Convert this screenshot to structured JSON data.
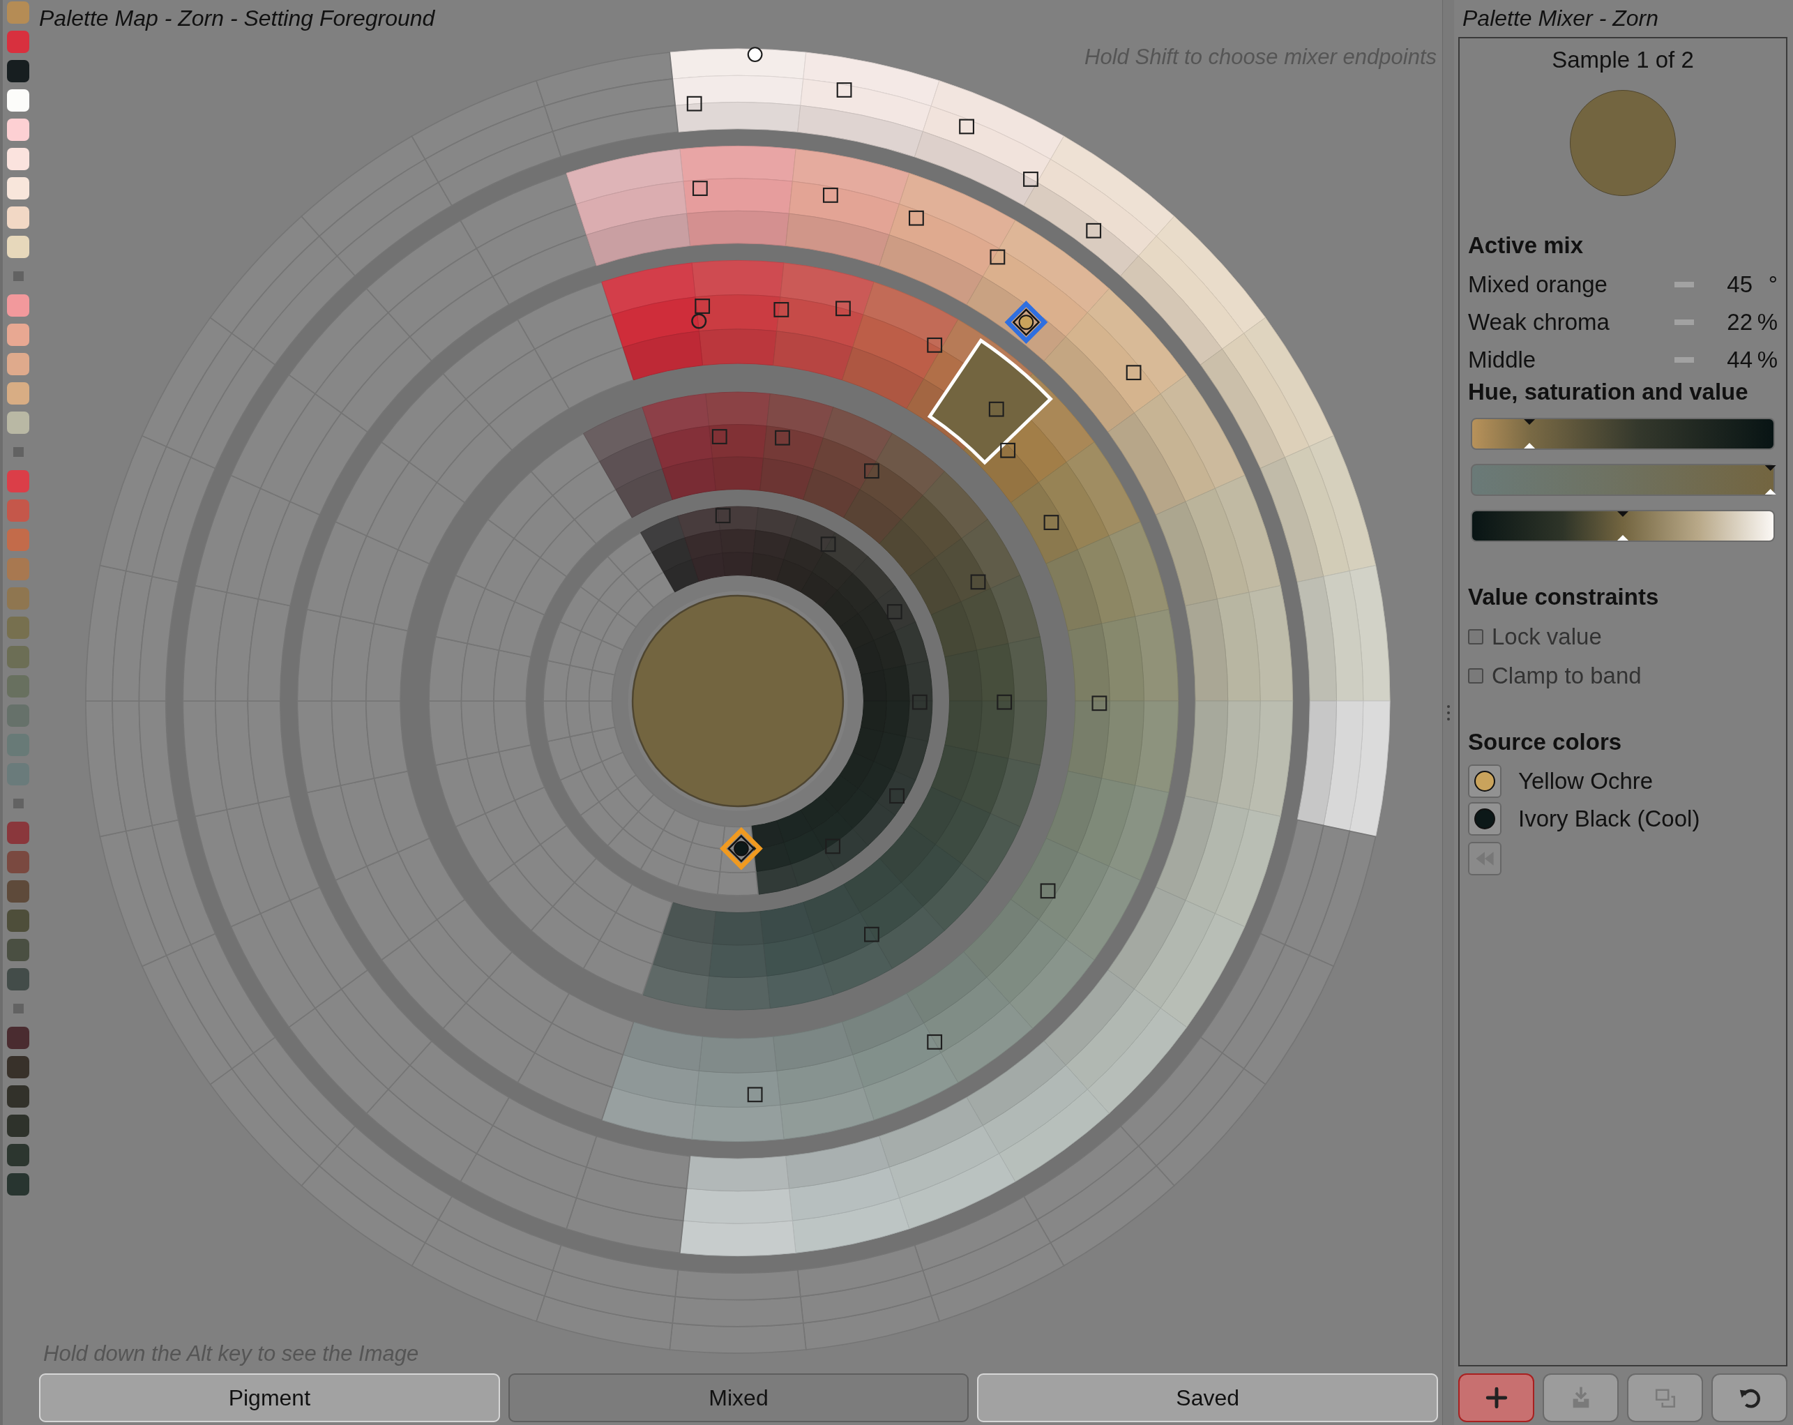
{
  "palette_map": {
    "title": "Palette Map - Zorn - Setting Foreground",
    "hint_top": "Hold Shift to choose mixer endpoints",
    "hint_bottom": "Hold down the Alt key to see the Image",
    "swatches": [
      {
        "kind": "swatch",
        "color": "#b58c55"
      },
      {
        "kind": "swatch",
        "color": "#d8303e"
      },
      {
        "kind": "swatch",
        "color": "#171e20"
      },
      {
        "kind": "swatch",
        "color": "#fcfcfa"
      },
      {
        "kind": "swatch",
        "color": "#fdd0d3"
      },
      {
        "kind": "swatch",
        "color": "#fbe3de"
      },
      {
        "kind": "swatch",
        "color": "#f8e6db"
      },
      {
        "kind": "swatch",
        "color": "#f2d8c5"
      },
      {
        "kind": "swatch",
        "color": "#e7d8bb"
      },
      {
        "kind": "separator"
      },
      {
        "kind": "swatch",
        "color": "#f2999c"
      },
      {
        "kind": "swatch",
        "color": "#e8a892"
      },
      {
        "kind": "swatch",
        "color": "#dfaa8c"
      },
      {
        "kind": "swatch",
        "color": "#d8ad84"
      },
      {
        "kind": "swatch",
        "color": "#b9b8a4"
      },
      {
        "kind": "separator"
      },
      {
        "kind": "swatch",
        "color": "#db3e48"
      },
      {
        "kind": "swatch",
        "color": "#c5574a"
      },
      {
        "kind": "swatch",
        "color": "#c36b4a"
      },
      {
        "kind": "swatch",
        "color": "#a87850"
      },
      {
        "kind": "swatch",
        "color": "#8f7650"
      },
      {
        "kind": "swatch",
        "color": "#77704f"
      },
      {
        "kind": "swatch",
        "color": "#6c6e55"
      },
      {
        "kind": "swatch",
        "color": "#68705f"
      },
      {
        "kind": "swatch",
        "color": "#66716a"
      },
      {
        "kind": "swatch",
        "color": "#687a77"
      },
      {
        "kind": "swatch",
        "color": "#6a7b7b"
      },
      {
        "kind": "separator"
      },
      {
        "kind": "swatch",
        "color": "#8a373c"
      },
      {
        "kind": "swatch",
        "color": "#7a4940"
      },
      {
        "kind": "swatch",
        "color": "#5e4a3a"
      },
      {
        "kind": "swatch",
        "color": "#4e4e3a"
      },
      {
        "kind": "swatch",
        "color": "#4a4f42"
      },
      {
        "kind": "swatch",
        "color": "#434c49"
      },
      {
        "kind": "separator"
      },
      {
        "kind": "swatch",
        "color": "#4a2c30"
      },
      {
        "kind": "swatch",
        "color": "#38312a"
      },
      {
        "kind": "swatch",
        "color": "#32312a"
      },
      {
        "kind": "swatch",
        "color": "#2e322b"
      },
      {
        "kind": "swatch",
        "color": "#2c362f"
      },
      {
        "kind": "swatch",
        "color": "#283530"
      }
    ],
    "tabs": [
      {
        "label": "Pigment",
        "selected": false
      },
      {
        "label": "Mixed",
        "selected": true
      },
      {
        "label": "Saved",
        "selected": false
      }
    ]
  },
  "palette_mixer": {
    "title": "Palette Mixer - Zorn",
    "sample": {
      "label": "Sample 1 of 2",
      "color": "#736540"
    },
    "active_mix": {
      "heading": "Active mix",
      "rows": [
        {
          "label": "Mixed orange",
          "value": "45",
          "unit": "°"
        },
        {
          "label": "Weak chroma",
          "value": "22",
          "unit": "%"
        },
        {
          "label": "Middle",
          "value": "44",
          "unit": "%"
        }
      ]
    },
    "hsv": {
      "heading": "Hue, saturation and value",
      "bars": [
        {
          "kind": "hue",
          "level": 0.19
        },
        {
          "kind": "saturation",
          "level": 0.99
        },
        {
          "kind": "value",
          "level": 0.5
        }
      ]
    },
    "constraints": {
      "heading": "Value constraints",
      "options": [
        {
          "label": "Lock value",
          "checked": false,
          "disabled": true
        },
        {
          "label": "Clamp to band",
          "checked": false,
          "disabled": true
        }
      ]
    },
    "sources": {
      "heading": "Source colors",
      "items": [
        {
          "name": "Yellow Ochre",
          "color": "#c9a35c"
        },
        {
          "name": "Ivory Black (Cool)",
          "color": "#0c1818"
        }
      ],
      "rewind": {
        "disabled": true
      }
    },
    "toolbar": [
      {
        "kind": "add",
        "disabled": false
      },
      {
        "kind": "import",
        "disabled": true
      },
      {
        "kind": "duplicate",
        "disabled": true
      },
      {
        "kind": "undo",
        "disabled": false
      }
    ]
  }
}
